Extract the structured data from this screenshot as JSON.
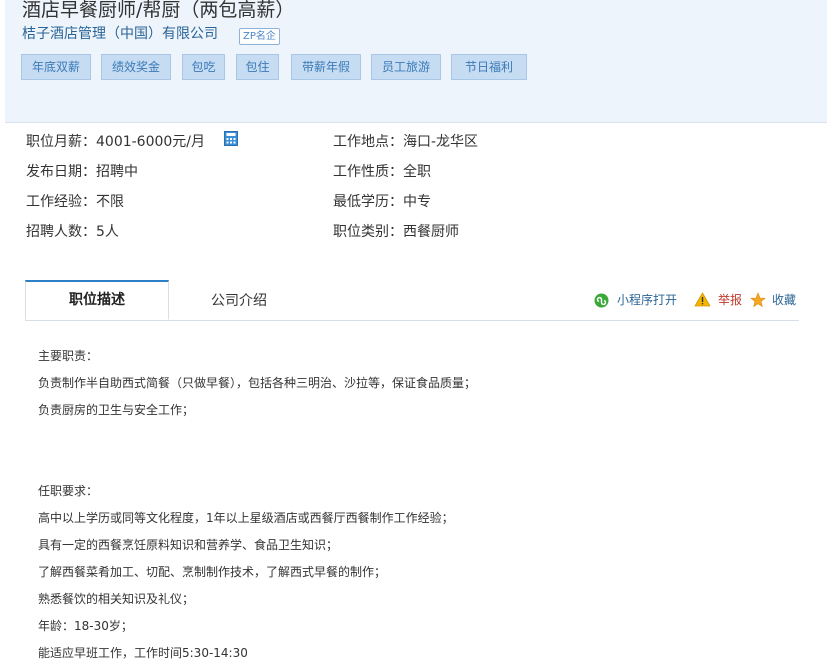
{
  "header": {
    "job_title": "酒店早餐厨师/帮厨（两包高薪）",
    "company": "桔子酒店管理（中国）有限公司",
    "company_badge": "ZP名企",
    "tags": [
      "年底双薪",
      "绩效奖金",
      "包吃",
      "包住",
      "带薪年假",
      "员工旅游",
      "节日福利"
    ]
  },
  "details": {
    "salary": "职位月薪：4001-6000元/月",
    "location": "工作地点：海口-龙华区",
    "publish_date": "发布日期：招聘中",
    "job_type": "工作性质：全职",
    "experience": "工作经验：不限",
    "education": "最低学历：中专",
    "headcount": "招聘人数：5人",
    "category": "职位类别：西餐厨师"
  },
  "tabs": {
    "active": "职位描述",
    "company_intro": "公司介绍"
  },
  "actions": {
    "miniprogram": "小程序打开",
    "report": "举报",
    "favorite": "收藏"
  },
  "description": {
    "lines": [
      "主要职责：",
      "负责制作半自助西式简餐（只做早餐），包括各种三明治、沙拉等，保证食品质量；",
      "负责厨房的卫生与安全工作；",
      "任职要求：",
      "高中以上学历或同等文化程度，1年以上星级酒店或西餐厅西餐制作工作经验；",
      "具有一定的西餐烹饪原料知识和营养学、食品卫生知识；",
      "了解西餐菜肴加工、切配、烹制制作技术，了解西式早餐的制作；",
      "熟悉餐饮的相关知识及礼仪；",
      "年龄：18-30岁；",
      "能适应早班工作，工作时间5:30-14:30"
    ]
  },
  "colors": {
    "accent": "#2d7fc7",
    "tag_bg": "#c5dcf2",
    "report": "#c0392b",
    "miniprogram_icon": "#3aa93a",
    "warning_icon": "#f5b400",
    "star_icon": "#f5a623"
  },
  "icons": [
    "calculator-icon",
    "miniprogram-icon",
    "warning-icon",
    "star-icon"
  ]
}
